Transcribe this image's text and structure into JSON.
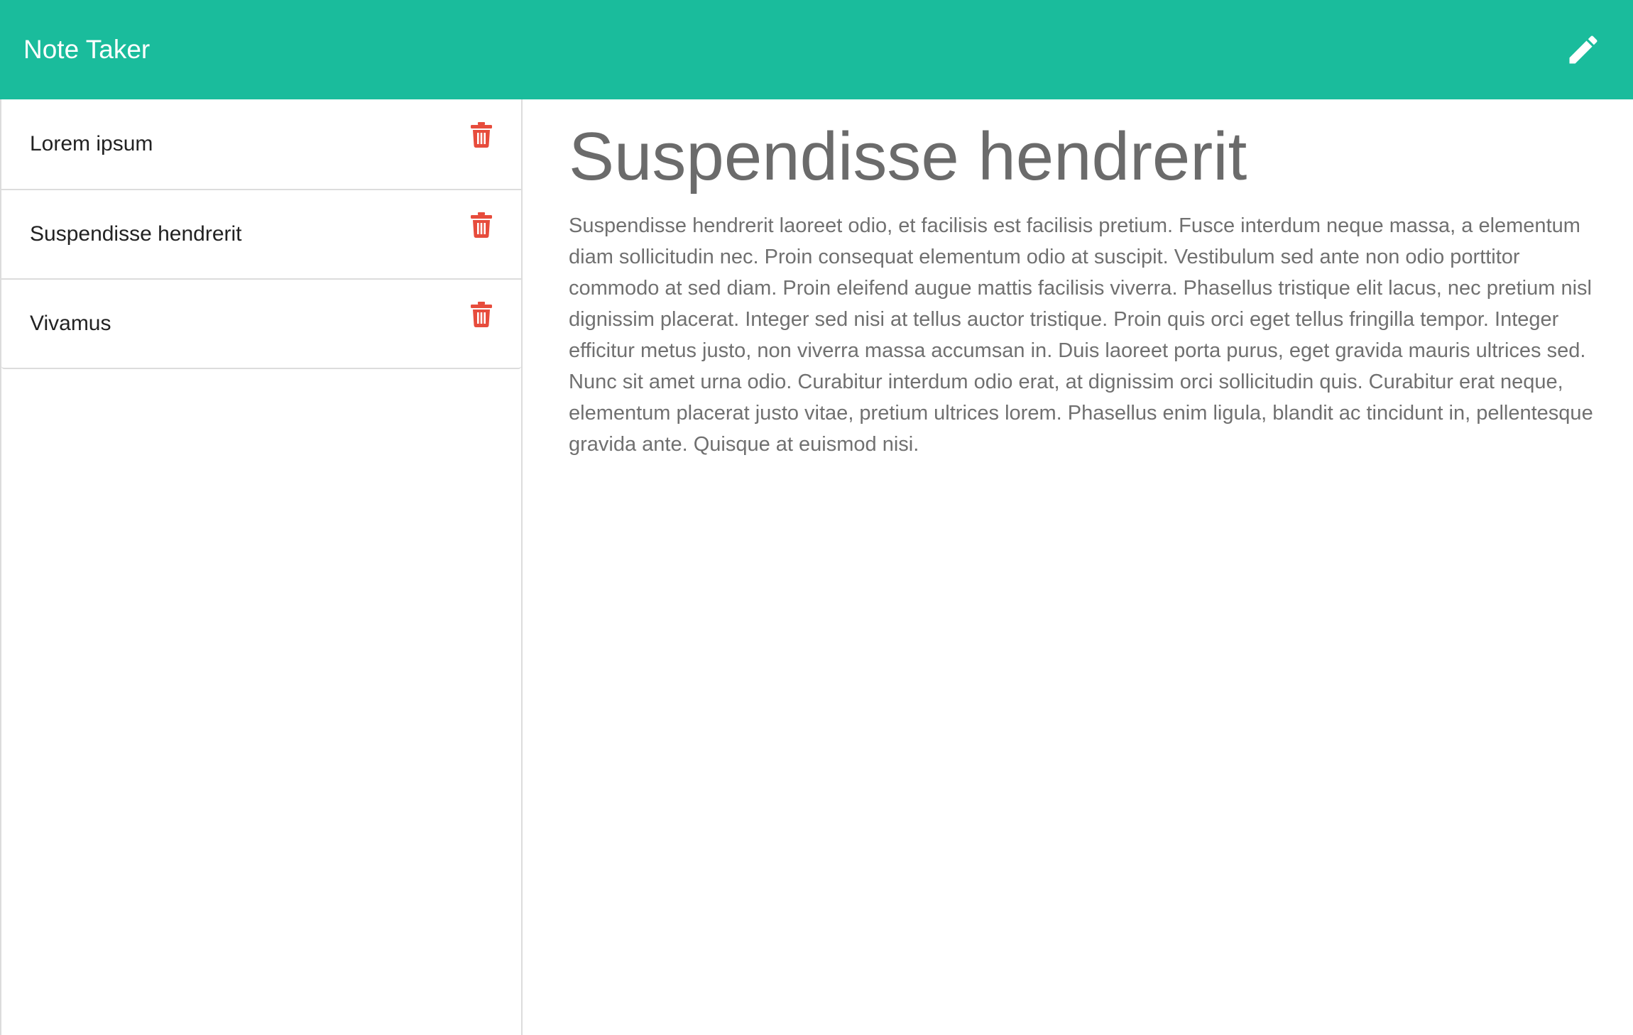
{
  "app": {
    "title": "Note Taker",
    "accent_color": "#1abc9c",
    "delete_color": "#e74c3c"
  },
  "navbar": {
    "edit_icon": "pencil-icon"
  },
  "sidebar": {
    "notes": [
      {
        "title": "Lorem ipsum",
        "delete_icon": "trash-icon"
      },
      {
        "title": "Suspendisse hendrerit",
        "delete_icon": "trash-icon"
      },
      {
        "title": "Vivamus",
        "delete_icon": "trash-icon"
      }
    ]
  },
  "active_note": {
    "title": "Suspendisse hendrerit",
    "text": "Suspendisse hendrerit laoreet odio, et facilisis est facilisis pretium. Fusce interdum neque massa, a elementum diam sollicitudin nec. Proin consequat elementum odio at suscipit. Vestibulum sed ante non odio porttitor commodo at sed diam. Proin eleifend augue mattis facilisis viverra. Phasellus tristique elit lacus, nec pretium nisl dignissim placerat. Integer sed nisi at tellus auctor tristique. Proin quis orci eget tellus fringilla tempor. Integer efficitur metus justo, non viverra massa accumsan in. Duis laoreet porta purus, eget gravida mauris ultrices sed. Nunc sit amet urna odio. Curabitur interdum odio erat, at dignissim orci sollicitudin quis. Curabitur erat neque, elementum placerat justo vitae, pretium ultrices lorem. Phasellus enim ligula, blandit ac tincidunt in, pellentesque gravida ante. Quisque at euismod nisi."
  }
}
